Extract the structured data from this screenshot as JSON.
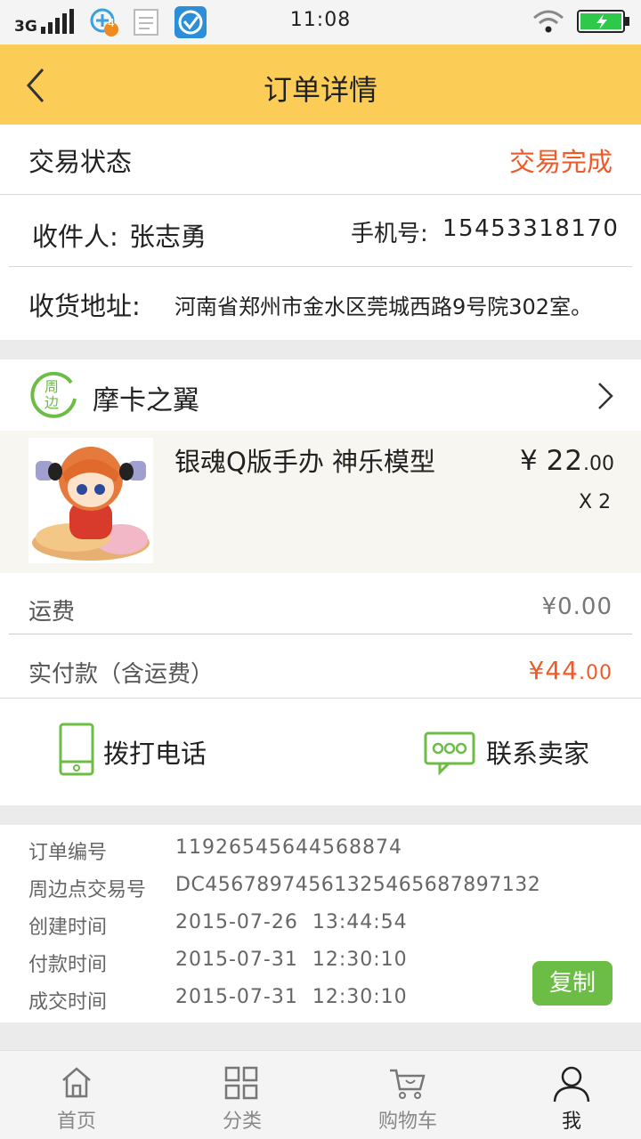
{
  "status_bar": {
    "network": "3G",
    "notification_count": "4",
    "time": "11:08"
  },
  "header": {
    "title": "订单详情"
  },
  "trade_status": {
    "label": "交易状态",
    "value": "交易完成"
  },
  "recipient": {
    "name_label": "收件人:",
    "name": "张志勇",
    "phone_label": "手机号:",
    "phone": "15453318170",
    "address_label": "收货地址:",
    "address": "河南省郑州市金水区莞城西路9号院302室。"
  },
  "shop": {
    "badge": "周边",
    "name": "摩卡之翼"
  },
  "product": {
    "title": "银魂Q版手办 神乐模型",
    "price_symbol": "¥",
    "price_int": "22",
    "price_dec": ".00",
    "quantity": "X 2"
  },
  "fees": {
    "shipping_label": "运费",
    "shipping_value": "¥0.00",
    "paid_label": "实付款（含运费）",
    "paid_value_int": "¥44",
    "paid_value_dec": ".00"
  },
  "actions": {
    "call": "拨打电话",
    "contact": "联系卖家"
  },
  "order_info": {
    "rows": [
      {
        "label": "订单编号",
        "value": "11926545644568874"
      },
      {
        "label": "周边点交易号",
        "value": "DC4567897456132546568789713​2"
      },
      {
        "label": "创建时间",
        "value": "2015-07-26  13:44:54"
      },
      {
        "label": "付款时间",
        "value": "2015-07-31  12:30:10"
      },
      {
        "label": "成交时间",
        "value": "2015-07-31  12:30:10"
      }
    ],
    "copy_button": "复制"
  },
  "tabbar": {
    "items": [
      {
        "label": "首页"
      },
      {
        "label": "分类"
      },
      {
        "label": "购物车"
      },
      {
        "label": "我"
      }
    ]
  },
  "colors": {
    "header_bg": "#fbcd57",
    "accent_red": "#f05a28",
    "accent_green": "#6cbd45",
    "product_bg": "#f8f6f0"
  }
}
